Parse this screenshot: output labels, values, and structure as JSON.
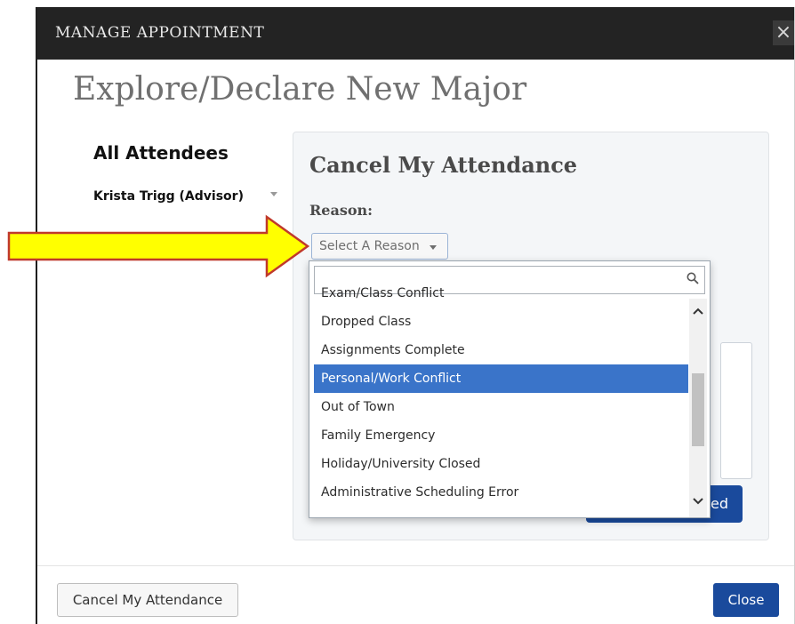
{
  "dialog": {
    "header_title": "MANAGE APPOINTMENT",
    "close_glyph": "×"
  },
  "page_title": "Explore/Declare New Major",
  "attendees": {
    "heading": "All Attendees",
    "items": [
      {
        "name": "Krista Trigg (Advisor)"
      }
    ]
  },
  "cancel_panel": {
    "title": "Cancel My Attendance",
    "reason_label": "Reason:",
    "select_placeholder": "Select A Reason",
    "dropdown": {
      "search_value": "",
      "partial_option": "Exam/Class Conflict",
      "options": [
        {
          "label": "Dropped Class"
        },
        {
          "label": "Assignments Complete"
        },
        {
          "label": "Personal/Work Conflict"
        },
        {
          "label": "Out of Town"
        },
        {
          "label": "Family Emergency"
        },
        {
          "label": "Holiday/University Closed"
        },
        {
          "label": "Administrative Scheduling Error"
        }
      ],
      "highlighted": "Personal/Work Conflict"
    },
    "submit_button_visible_text": "ed"
  },
  "footer": {
    "cancel_button": "Cancel My Attendance",
    "close_button": "Close"
  },
  "colors": {
    "header_bg": "#232323",
    "primary_blue": "#1a4a9c",
    "highlight": "#3a74c9",
    "arrow_fill": "#ffff00",
    "arrow_stroke": "#c0392b"
  }
}
